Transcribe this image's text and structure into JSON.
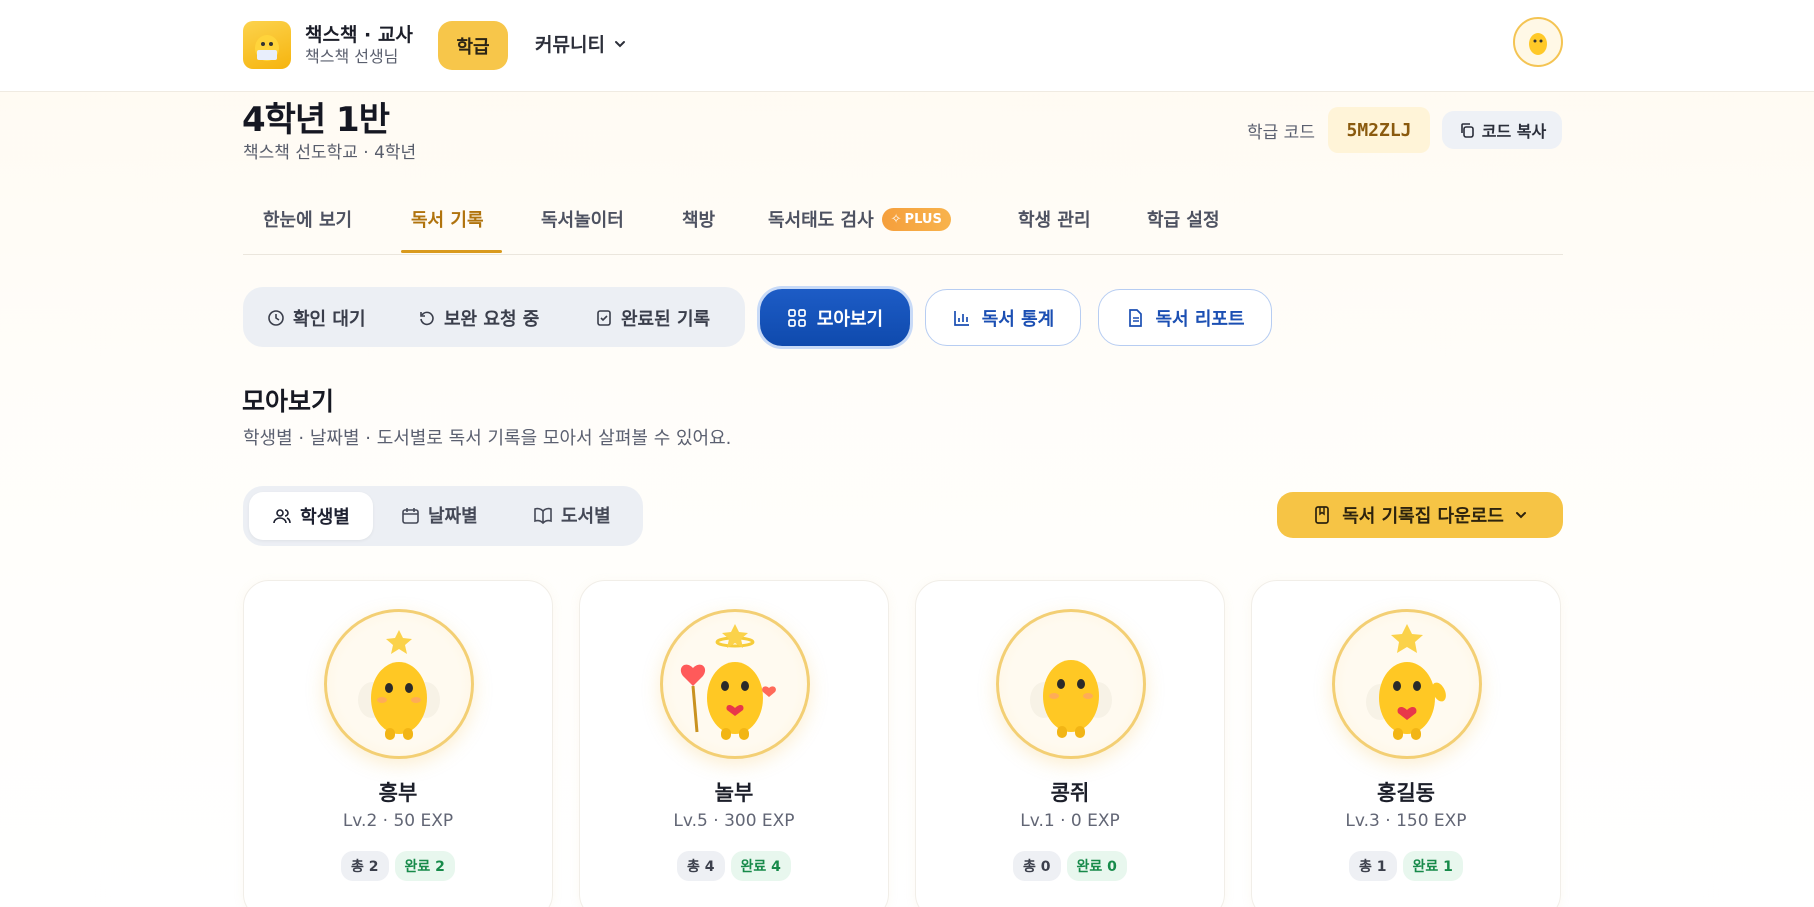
{
  "header": {
    "brand_title": "책스책 · 교사",
    "brand_subtitle": "책스책 선생님",
    "nav_class": "학급",
    "nav_community": "커뮤니티"
  },
  "class_info": {
    "title": "4학년 1반",
    "subtitle": "책스책 선도학교 · 4학년",
    "code_label": "학급 코드",
    "code_value": "5M2ZLJ",
    "copy_label": "코드 복사"
  },
  "tabs": [
    {
      "label": "한눈에 보기"
    },
    {
      "label": "독서 기록"
    },
    {
      "label": "독서놀이터"
    },
    {
      "label": "책방"
    },
    {
      "label": "독서태도 검사",
      "badge": "PLUS"
    },
    {
      "label": "학생 관리"
    },
    {
      "label": "학급 설정"
    }
  ],
  "active_tab": "독서 기록",
  "filters": {
    "pending": "확인 대기",
    "revision": "보완 요청 중",
    "completed": "완료된 기록",
    "overview": "모아보기",
    "stats": "독서 통계",
    "report": "독서 리포트"
  },
  "section": {
    "title": "모아보기",
    "description": "학생별 · 날짜별 · 도서별로 독서 기록을 모아서 살펴볼 수 있어요."
  },
  "view_modes": {
    "by_student": "학생별",
    "by_date": "날짜별",
    "by_book": "도서별",
    "active": "학생별"
  },
  "download_label": "독서 기록집 다운로드",
  "students": [
    {
      "name": "흥부",
      "level": "Lv.2 · 50 EXP",
      "total": "총 2",
      "done": "완료 2"
    },
    {
      "name": "놀부",
      "level": "Lv.5 · 300 EXP",
      "total": "총 4",
      "done": "완료 4"
    },
    {
      "name": "콩쥐",
      "level": "Lv.1 · 0 EXP",
      "total": "총 0",
      "done": "완료 0"
    },
    {
      "name": "홍길동",
      "level": "Lv.3 · 150 EXP",
      "total": "총 1",
      "done": "완료 1"
    }
  ],
  "colors": {
    "accent_yellow": "#f6c445",
    "active_tab": "#b0730d",
    "primary_blue": "#1552b8",
    "success_green": "#178a4a"
  }
}
